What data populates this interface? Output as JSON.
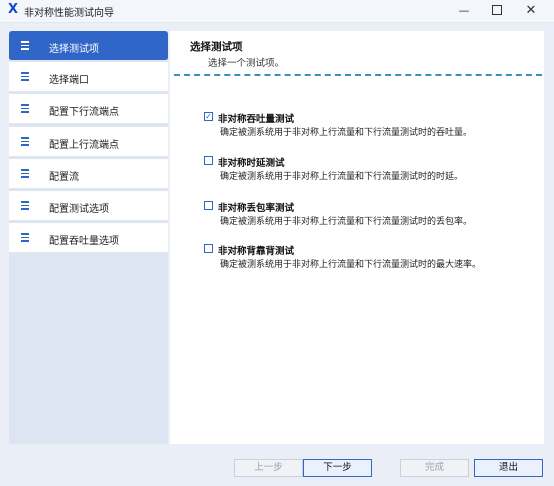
{
  "window": {
    "title": "非对称性能测试向导",
    "app_icon": "X"
  },
  "window_controls": {
    "minimize": "—",
    "maximize": "",
    "close": "✕"
  },
  "sidebar": {
    "items": [
      {
        "label": "选择测试项",
        "active": true
      },
      {
        "label": "选择端口"
      },
      {
        "label": "配置下行流端点"
      },
      {
        "label": "配置上行流端点"
      },
      {
        "label": "配置流"
      },
      {
        "label": "配置测试选项"
      },
      {
        "label": "配置吞吐量选项"
      }
    ]
  },
  "main": {
    "title": "选择测试项",
    "subtitle": "选择一个测试项。",
    "options": [
      {
        "title": "非对称吞吐量测试",
        "checked": true,
        "check": "✓",
        "desc": "确定被测系统用于非对称上行流量和下行流量测试时的吞吐量。"
      },
      {
        "title": "非对称时延测试",
        "checked": false,
        "check": "",
        "desc": "确定被测系统用于非对称上行流量和下行流量测试时的时延。"
      },
      {
        "title": "非对称丢包率测试",
        "checked": false,
        "check": "",
        "desc": "确定被测系统用于非对称上行流量和下行流量测试时的丢包率。"
      },
      {
        "title": "非对称背靠背测试",
        "checked": false,
        "check": "",
        "desc": "确定被测系统用于非对称上行流量和下行流量测试时的最大速率。"
      }
    ]
  },
  "footer": {
    "prev": "上一步",
    "next": "下一步",
    "finish": "完成",
    "exit": "退出"
  },
  "colors": {
    "accent": "#2f66c8",
    "dash": "#3a8fb7",
    "sidebar_bg": "#dde5f2"
  }
}
